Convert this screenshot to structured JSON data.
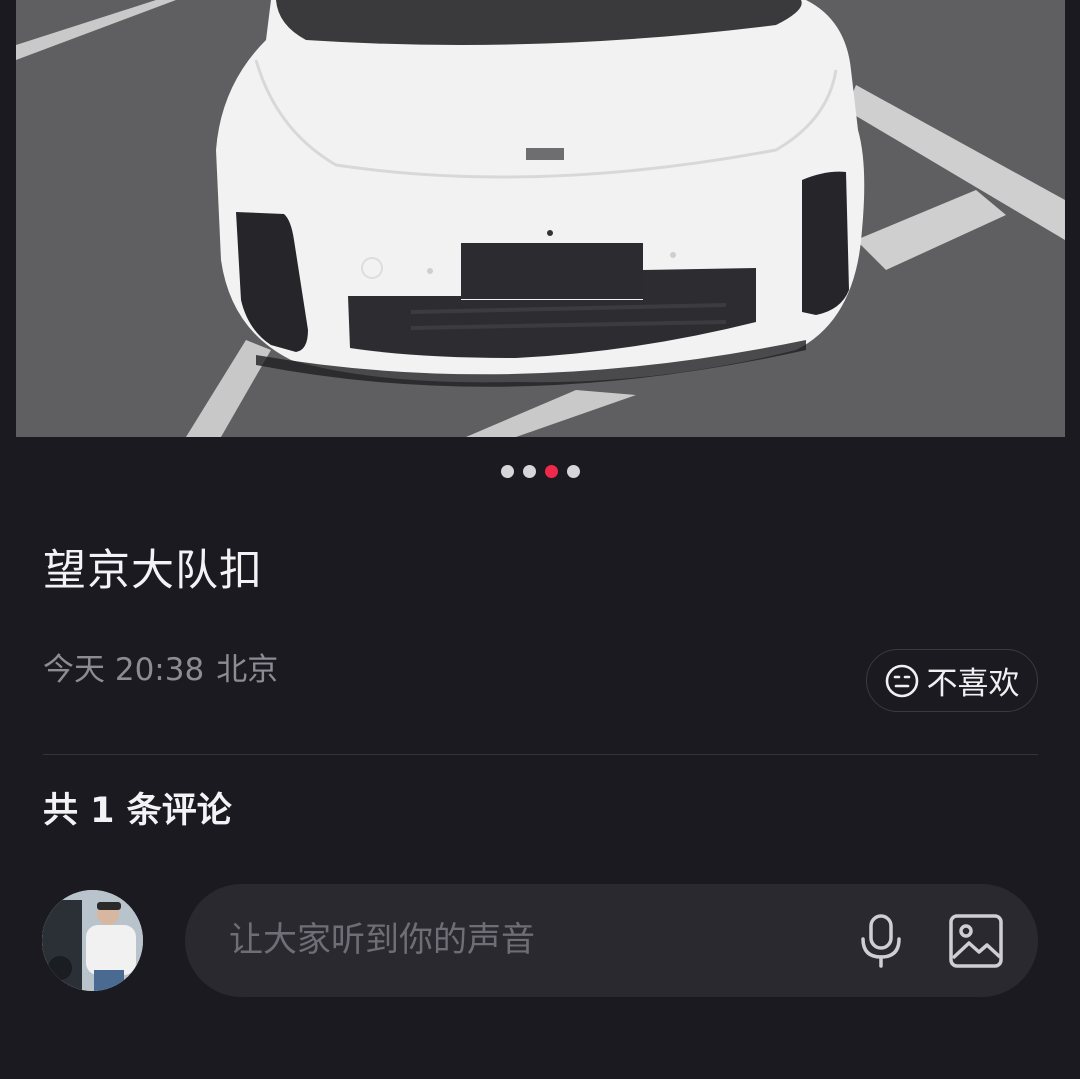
{
  "carousel": {
    "page_count": 4,
    "active_index": 2,
    "active_color": "#f0284a",
    "inactive_color": "#d6d6d9"
  },
  "post": {
    "title": "望京大队扣",
    "time": "今天 20:38",
    "location": "北京",
    "dislike_label": "不喜欢",
    "dislike_icon": "neutral-face-icon"
  },
  "comments": {
    "count_label": "共 1 条评论"
  },
  "input": {
    "placeholder": "让大家听到你的声音",
    "voice_icon": "microphone-icon",
    "image_icon": "image-icon"
  }
}
